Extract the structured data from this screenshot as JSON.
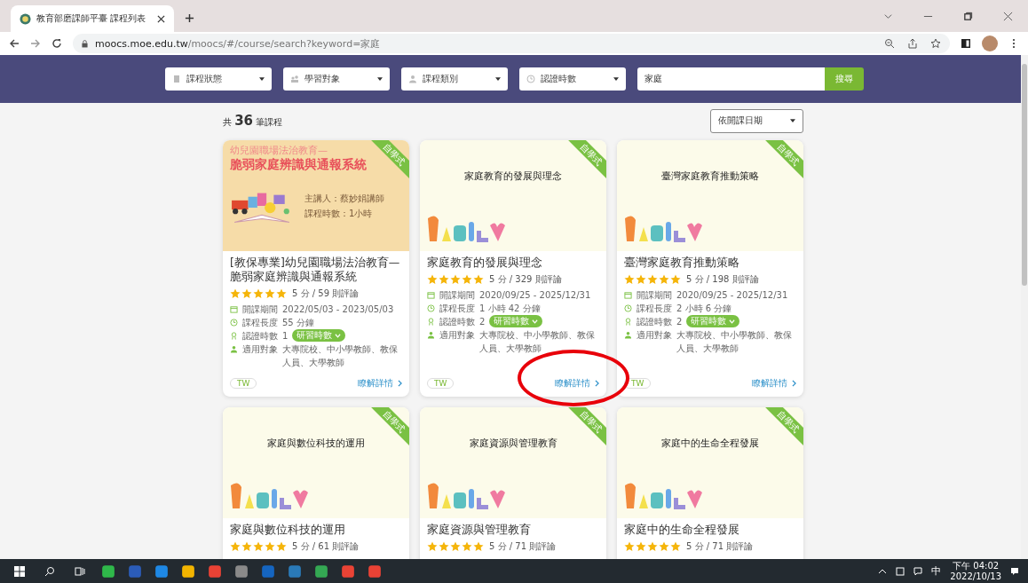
{
  "browser": {
    "tab_title": "教育部磨課師平臺 課程列表",
    "url_host": "moocs.moe.edu.tw",
    "url_path": "/moocs/#/course/search?keyword=家庭"
  },
  "filters": [
    {
      "label": "課程狀態"
    },
    {
      "label": "學習對象"
    },
    {
      "label": "課程類別"
    },
    {
      "label": "認證時數"
    }
  ],
  "search": {
    "value": "家庭",
    "button": "搜尋"
  },
  "result_count": {
    "prefix": "共",
    "count": "36",
    "suffix": "筆課程"
  },
  "sort": {
    "value": "依開課日期"
  },
  "courses": [
    {
      "kind": "poster",
      "cover_title": "幼兒園職場法治教育—",
      "cover_subtitle": "脆弱家庭辨識與通報系統",
      "cover_lines": [
        "主講人：蔡妙娟講師",
        "課程時數：1小時"
      ],
      "badge": "自學式",
      "title": "[教保專業]幼兒園職場法治教育—脆弱家庭辨識與通報系統",
      "stars": 5,
      "rating": "5 分 / 59 則評論",
      "info": [
        {
          "label": "開課期間",
          "value": "2022/05/03 - 2023/05/03"
        },
        {
          "label": "課程長度",
          "value": "55 分鐘"
        },
        {
          "label": "認證時數",
          "value": "1",
          "button": "研習時數"
        },
        {
          "label": "適用對象",
          "value": "大專院校、中小學教師、教保人員、大學教師"
        }
      ],
      "lang": "TW",
      "details": "瞭解詳情"
    },
    {
      "kind": "family",
      "cover_title": "家庭教育的發展與理念",
      "badge": "自學式",
      "title": "家庭教育的發展與理念",
      "stars": 5,
      "rating": "5 分 / 329 則評論",
      "info": [
        {
          "label": "開課期間",
          "value": "2020/09/25 - 2025/12/31"
        },
        {
          "label": "課程長度",
          "value": "1 小時 42 分鐘"
        },
        {
          "label": "認證時數",
          "value": "2",
          "button": "研習時數"
        },
        {
          "label": "適用對象",
          "value": "大專院校、中小學教師、教保人員、大學教師"
        }
      ],
      "lang": "TW",
      "details": "瞭解詳情"
    },
    {
      "kind": "family",
      "cover_title": "臺灣家庭教育推動策略",
      "badge": "自學式",
      "title": "臺灣家庭教育推動策略",
      "stars": 5,
      "rating": "5 分 / 198 則評論",
      "info": [
        {
          "label": "開課期間",
          "value": "2020/09/25 - 2025/12/31"
        },
        {
          "label": "課程長度",
          "value": "2 小時 6 分鐘"
        },
        {
          "label": "認證時數",
          "value": "2",
          "button": "研習時數"
        },
        {
          "label": "適用對象",
          "value": "大專院校、中小學教師、教保人員、大學教師"
        }
      ],
      "lang": "TW",
      "details": "瞭解詳情"
    },
    {
      "kind": "family",
      "cover_title": "家庭與數位科技的運用",
      "badge": "自學式",
      "title": "家庭與數位科技的運用",
      "stars": 5,
      "rating": "5 分 / 61 則評論"
    },
    {
      "kind": "family",
      "cover_title": "家庭資源與管理教育",
      "badge": "自學式",
      "title": "家庭資源與管理教育",
      "stars": 5,
      "rating": "5 分 / 71 則評論"
    },
    {
      "kind": "family",
      "cover_title": "家庭中的生命全程發展",
      "badge": "自學式",
      "title": "家庭中的生命全程發展",
      "stars": 5,
      "rating": "5 分 / 71 則評論"
    }
  ],
  "taskbar": {
    "ime": "中",
    "time": "下午 04:02",
    "date": "2022/10/13"
  }
}
